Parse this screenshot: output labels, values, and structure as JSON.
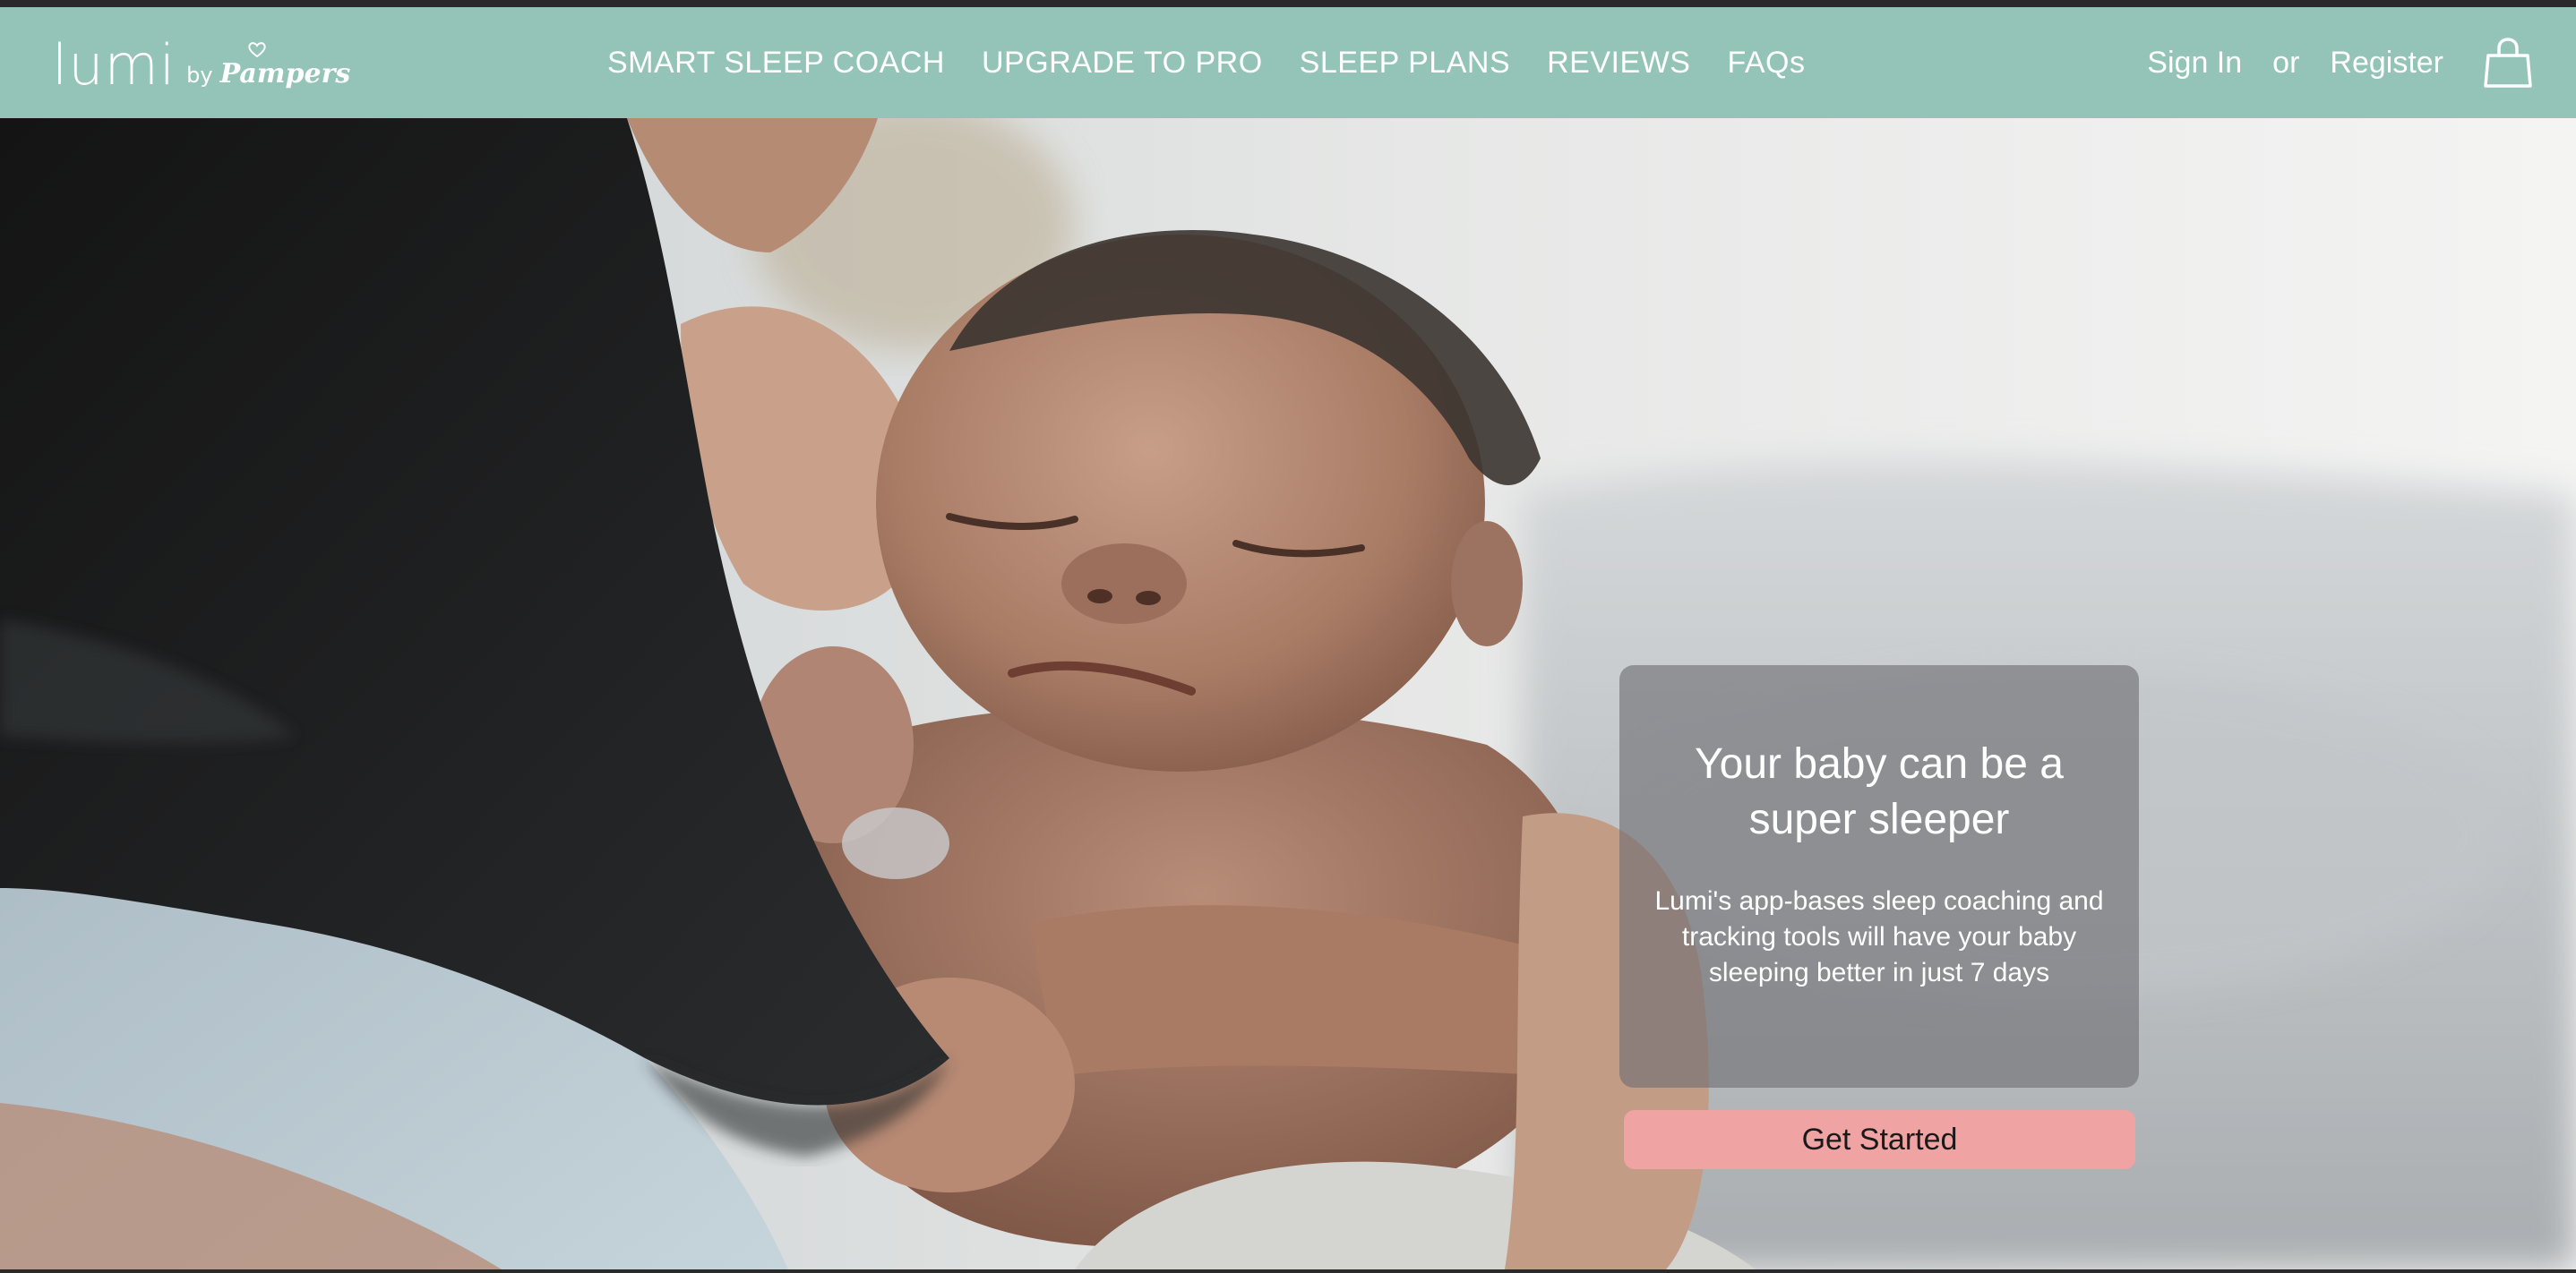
{
  "brand": {
    "name": "lumi",
    "by": "by",
    "partner": "Pampers"
  },
  "nav": {
    "items": [
      {
        "label": "SMART SLEEP COACH"
      },
      {
        "label": "UPGRADE TO PRO"
      },
      {
        "label": "SLEEP PLANS"
      },
      {
        "label": "REVIEWS"
      },
      {
        "label": "FAQs"
      }
    ],
    "sign_in": "Sign In",
    "or": "or",
    "register": "Register",
    "cart_icon": "shopping-bag-icon"
  },
  "hero": {
    "title": "Your baby can be a super sleeper",
    "text": "Lumi's app-bases sleep coaching and tracking tools will have your baby sleeping better in just 7 days",
    "cta": "Get Started",
    "image": "parent-holding-sleeping-newborn"
  },
  "colors": {
    "nav_background": "#94c4b8",
    "cta_background": "#f0a3a3",
    "card_background": "rgba(110,110,115,0.62)",
    "text_light": "#ffffff"
  }
}
